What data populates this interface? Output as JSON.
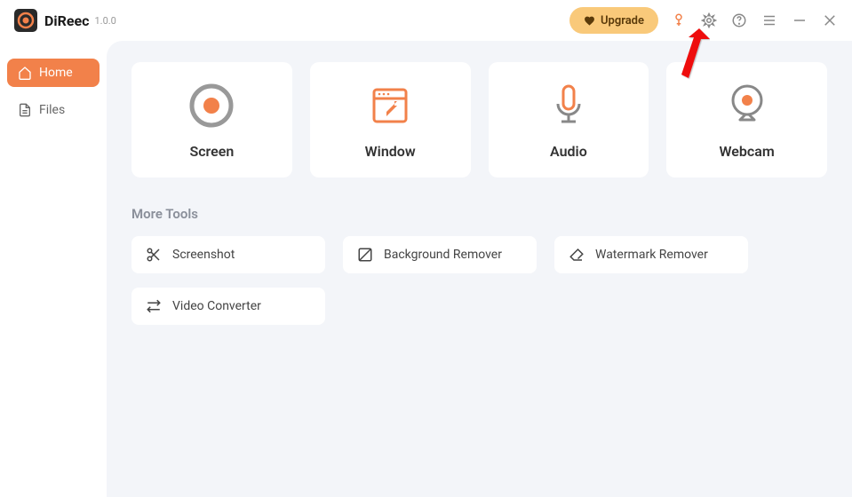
{
  "app": {
    "name": "DiReec",
    "version": "1.0.0"
  },
  "titlebar": {
    "upgrade_label": "Upgrade"
  },
  "sidebar": {
    "items": [
      {
        "label": "Home",
        "active": true
      },
      {
        "label": "Files",
        "active": false
      }
    ]
  },
  "main": {
    "cards": [
      {
        "label": "Screen"
      },
      {
        "label": "Window"
      },
      {
        "label": "Audio"
      },
      {
        "label": "Webcam"
      }
    ],
    "more_tools_label": "More Tools",
    "tools": [
      {
        "label": "Screenshot"
      },
      {
        "label": "Background Remover"
      },
      {
        "label": "Watermark Remover"
      },
      {
        "label": "Video Converter"
      }
    ]
  },
  "colors": {
    "accent": "#f2814a",
    "upgrade": "#f9c97a"
  }
}
